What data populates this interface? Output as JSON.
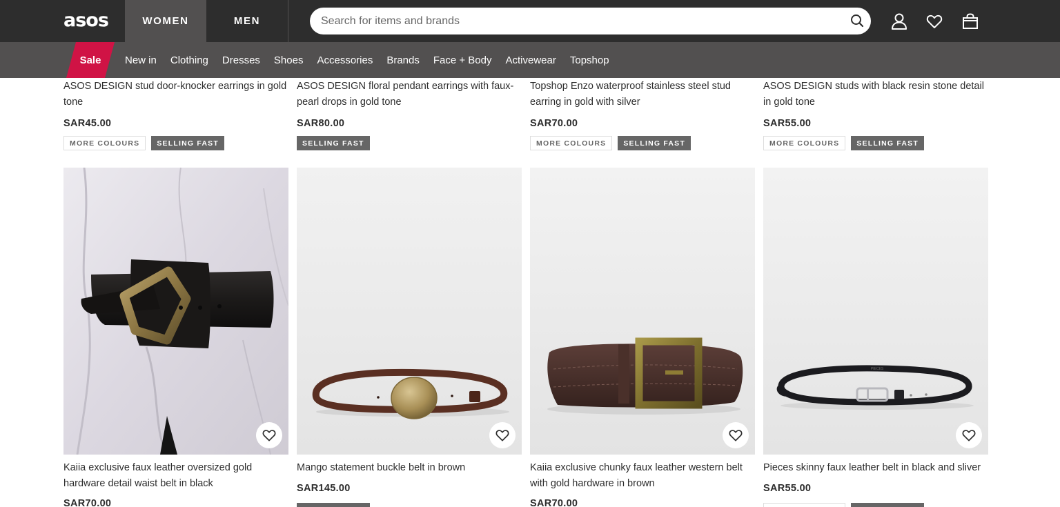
{
  "header": {
    "logo": "asos",
    "tabs": [
      {
        "label": "WOMEN",
        "active": true
      },
      {
        "label": "MEN",
        "active": false
      }
    ],
    "search": {
      "placeholder": "Search for items and brands",
      "value": ""
    },
    "icons": [
      "search-icon",
      "account-icon",
      "heart-icon",
      "bag-icon"
    ]
  },
  "nav": {
    "sale_label": "Sale",
    "items": [
      "New in",
      "Clothing",
      "Dresses",
      "Shoes",
      "Accessories",
      "Brands",
      "Face + Body",
      "Activewear",
      "Topshop"
    ]
  },
  "colors": {
    "header_bg": "#2d2d2d",
    "nav_bg": "#525050",
    "sale_bg": "#d01345",
    "badge_bg": "#666666"
  },
  "badges": {
    "more_colours": "MORE COLOURS",
    "selling_fast": "SELLING FAST"
  },
  "products_row1": [
    {
      "title": "ASOS DESIGN stud door-knocker earrings in gold tone",
      "price": "SAR45.00"
    },
    {
      "title": "ASOS DESIGN floral pendant earrings with faux-pearl drops in gold tone",
      "price": "SAR80.00"
    },
    {
      "title": "Topshop Enzo waterproof stainless steel stud earring in gold with silver",
      "price": "SAR70.00"
    },
    {
      "title": "ASOS DESIGN studs with black resin stone detail in gold tone",
      "price": "SAR55.00"
    }
  ],
  "products_row2": [
    {
      "title": "Kaiia exclusive faux leather oversized gold hardware detail waist belt in black",
      "price": "SAR70.00"
    },
    {
      "title": "Mango statement buckle belt in brown",
      "price": "SAR145.00"
    },
    {
      "title": "Kaiia exclusive chunky faux leather western belt with gold hardware in brown",
      "price": "SAR70.00"
    },
    {
      "title": "Pieces skinny faux leather belt in black and sliver",
      "price": "SAR55.00",
      "belt_print": "PIECES"
    }
  ]
}
